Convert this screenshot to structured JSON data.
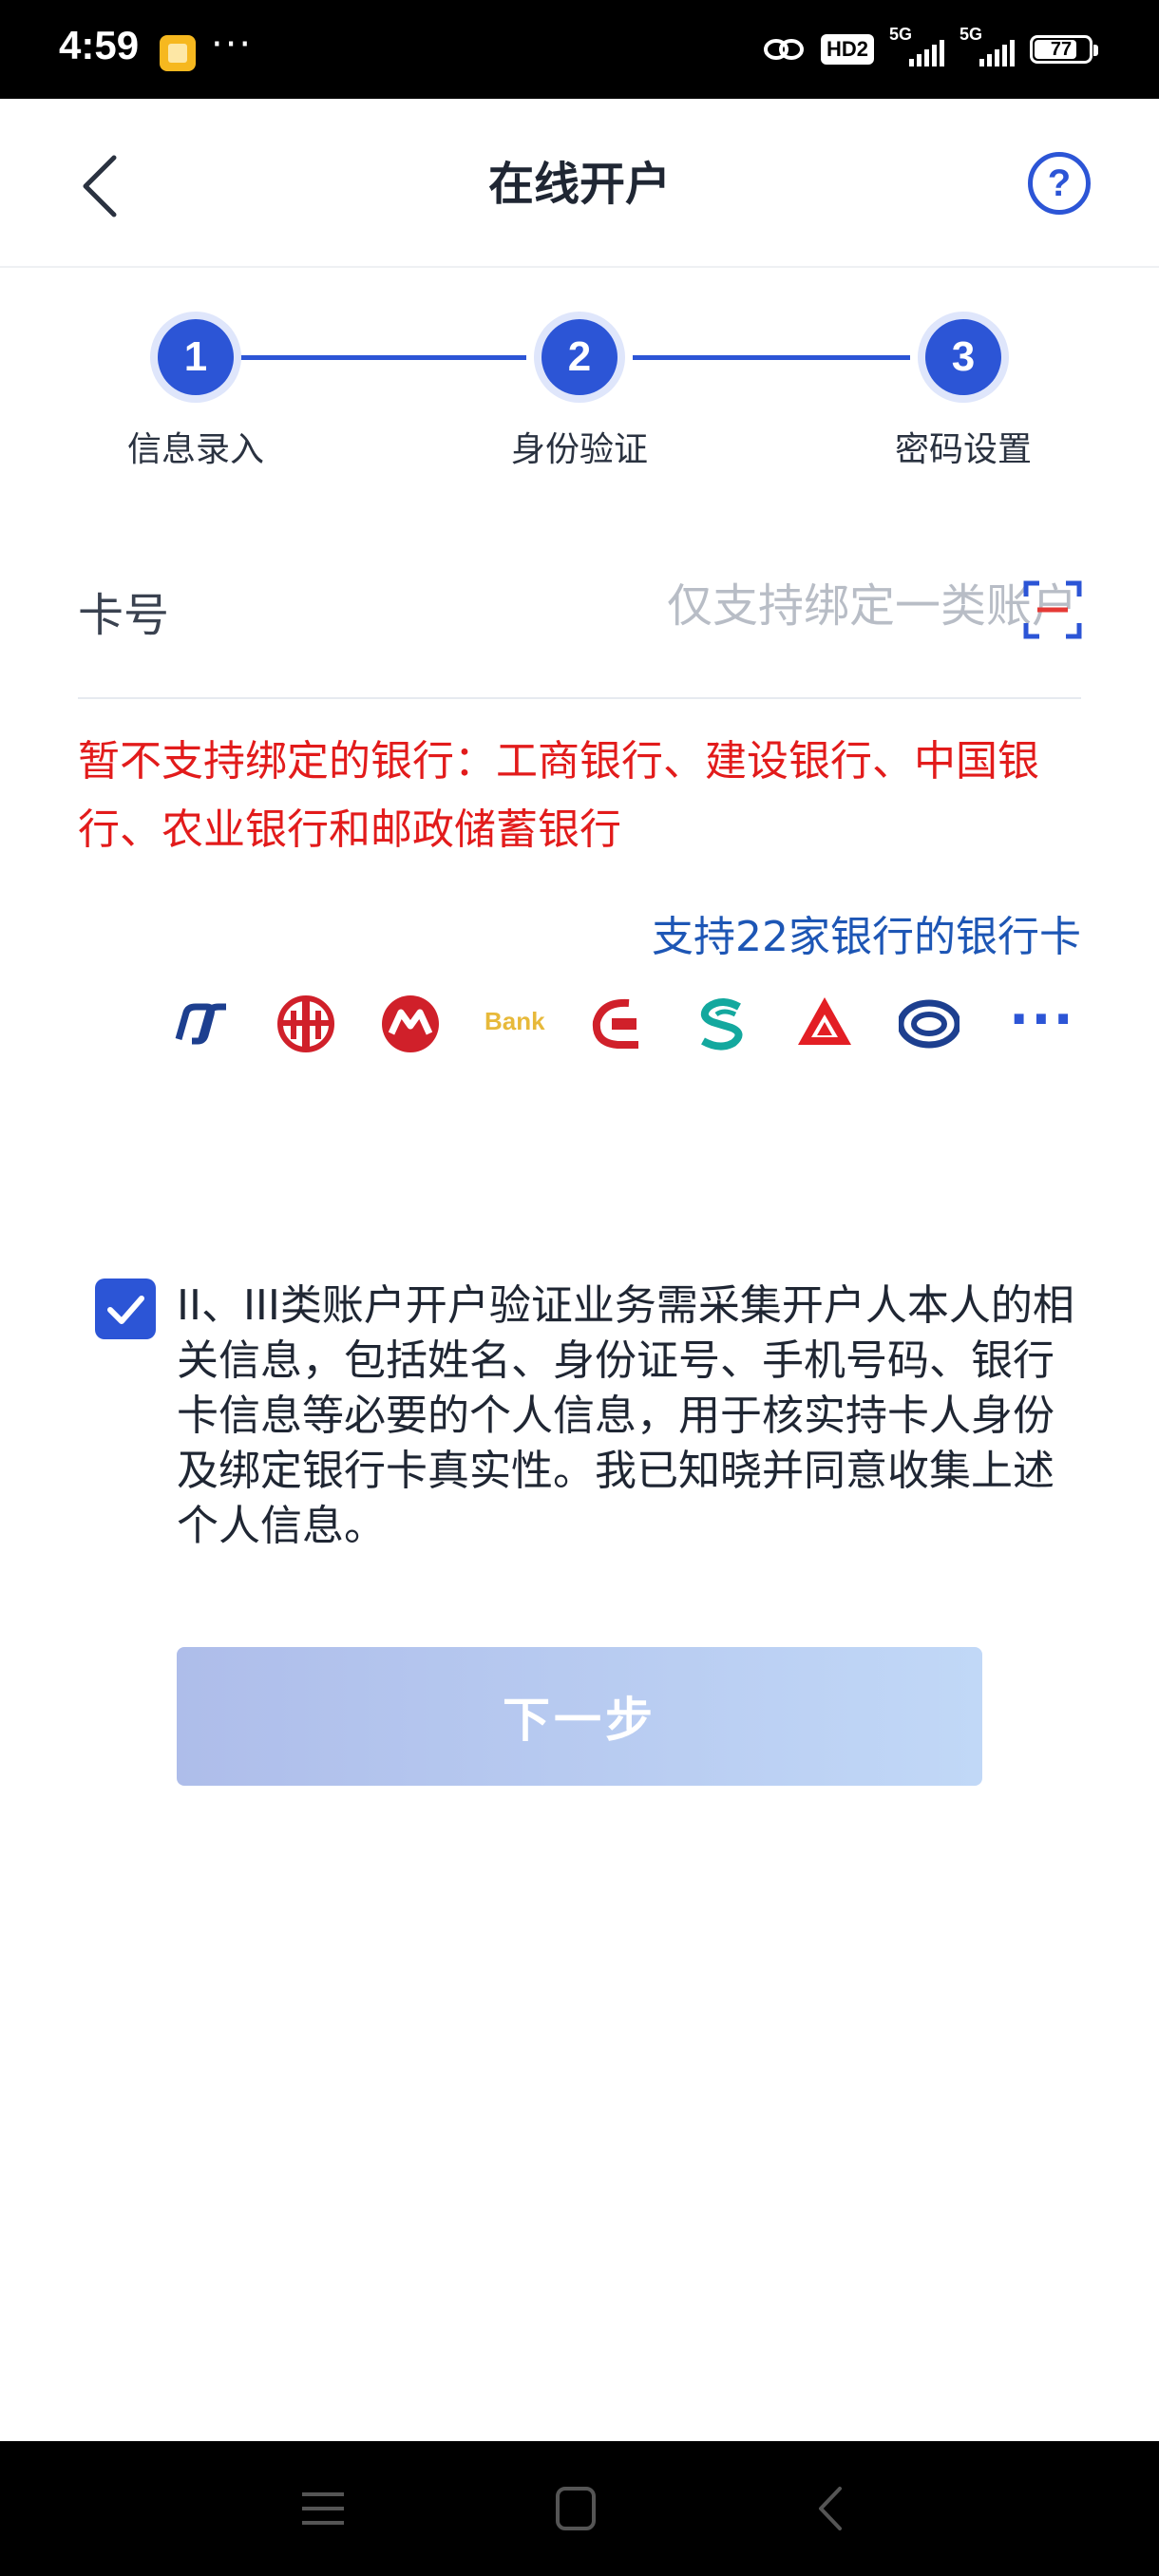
{
  "status_bar": {
    "time": "4:59",
    "dots": "···",
    "hd_label": "HD2",
    "signal1_label": "5G",
    "signal2_label": "5G",
    "battery": "77"
  },
  "header": {
    "title": "在线开户",
    "help_label": "?"
  },
  "steps": [
    {
      "number": "1",
      "label": "信息录入"
    },
    {
      "number": "2",
      "label": "身份验证"
    },
    {
      "number": "3",
      "label": "密码设置"
    }
  ],
  "form": {
    "card_label": "卡号",
    "card_value": "",
    "card_placeholder": "仅支持绑定一类账户"
  },
  "unsupported_notice": "暂不支持绑定的银行：工商银行、建设银行、中国银行、农业银行和邮政储蓄银行",
  "supported_banks_link": "支持22家银行的银行卡",
  "bank_logos": {
    "bank4_text": "Bank",
    "more": "···"
  },
  "consent": {
    "checked": true,
    "text": "II、III类账户开户验证业务需采集开户人本人的相关信息，包括姓名、身份证号、手机号码、银行卡信息等必要的个人信息，用于核实持卡人身份及绑定银行卡真实性。我已知晓并同意收集上述个人信息。"
  },
  "next_button": "下一步",
  "colors": {
    "primary": "#2c55d6",
    "warning": "#e21b1b",
    "link": "#1d56b5"
  }
}
